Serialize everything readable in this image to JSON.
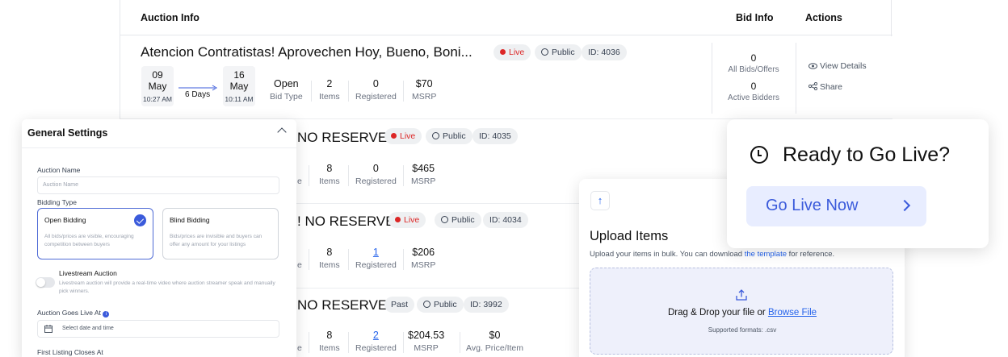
{
  "table": {
    "headers": {
      "auction_info": "Auction Info",
      "bid_info": "Bid Info",
      "actions": "Actions"
    }
  },
  "rows": [
    {
      "title": "Atencion Contratistas! Aprovechen Hoy, Bueno, Boni...",
      "status": "Live",
      "visibility": "Public",
      "id": "ID: 4036",
      "start": {
        "day": "09",
        "month": "May",
        "time": "10:27 AM"
      },
      "duration": "6 Days",
      "end": {
        "day": "16",
        "month": "May",
        "time": "10:11 AM"
      },
      "bid_type": {
        "value": "Open",
        "label": "Bid Type"
      },
      "items": {
        "value": "2",
        "label": "Items"
      },
      "registered": {
        "value": "0",
        "label": "Registered"
      },
      "msrp": {
        "value": "$70",
        "label": "MSRP"
      },
      "bids": {
        "value": "0",
        "label": "All Bids/Offers"
      },
      "bidders": {
        "value": "0",
        "label": "Active Bidders"
      },
      "view_details": "View Details",
      "share": "Share"
    },
    {
      "title": "NO RESERVES",
      "status": "Live",
      "visibility": "Public",
      "id": "ID: 4035",
      "bid_type_fragment": "e",
      "items": {
        "value": "8",
        "label": "Items"
      },
      "registered": {
        "value": "0",
        "label": "Registered"
      },
      "msrp": {
        "value": "$465",
        "label": "MSRP"
      }
    },
    {
      "title": "! NO RESERVES",
      "status": "Live",
      "visibility": "Public",
      "id": "ID: 4034",
      "bid_type_fragment": "e",
      "items": {
        "value": "8",
        "label": "Items"
      },
      "registered": {
        "value": "1",
        "label": "Registered"
      },
      "msrp": {
        "value": "$206",
        "label": "MSRP"
      }
    },
    {
      "title": "NO RESERVES!",
      "status": "Past",
      "visibility": "Public",
      "id": "ID: 3992",
      "bid_type_fragment": "e",
      "items": {
        "value": "8",
        "label": "Items"
      },
      "registered": {
        "value": "2",
        "label": "Registered"
      },
      "msrp": {
        "value": "$204.53",
        "label": "MSRP"
      },
      "avg": {
        "value": "$0",
        "label": "Avg. Price/Item"
      }
    }
  ],
  "settings": {
    "title": "General Settings",
    "auction_name_label": "Auction Name",
    "auction_name_placeholder": "Auction Name",
    "bidding_type_label": "Bidding Type",
    "open_bidding": {
      "title": "Open Bidding",
      "desc": "All bids/prices are visible, encouraging competition between buyers"
    },
    "blind_bidding": {
      "title": "Blind Bidding",
      "desc": "Bids/prices are invisible and buyers can offer any amount for your listings"
    },
    "livestream_title": "Livestream Auction",
    "livestream_desc": "Livestream auction will provide a real-time video where auction streamer speak and manually pick winners.",
    "goes_live_label": "Auction Goes Live At",
    "date_placeholder": "Select date and time",
    "first_closes_label": "First Listing Closes At"
  },
  "upload": {
    "title": "Upload Items",
    "desc_before": "Upload your items in bulk. You can download ",
    "desc_link": "the template",
    "desc_after": " for reference.",
    "drop_text": "Drag & Drop your file or ",
    "browse": "Browse File",
    "formats": "Supported formats: .csv"
  },
  "golive": {
    "title": "Ready to Go Live?",
    "button": "Go Live Now"
  },
  "colors": {
    "accent": "#3b5bdb",
    "live": "#dc2626",
    "link": "#2563eb"
  }
}
